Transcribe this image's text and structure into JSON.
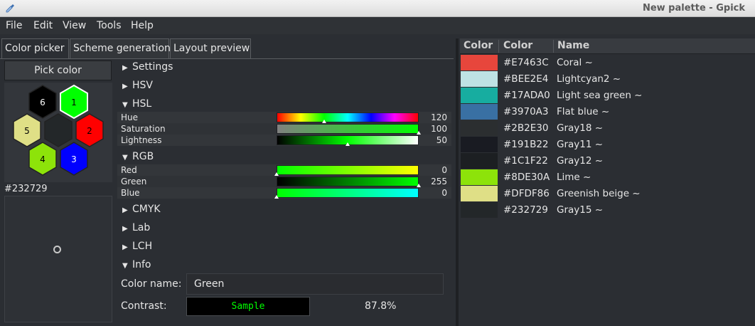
{
  "window": {
    "title": "New palette - Gpick"
  },
  "menu": [
    "File",
    "Edit",
    "View",
    "Tools",
    "Help"
  ],
  "tabs": [
    "Color picker",
    "Scheme generation",
    "Layout preview"
  ],
  "picker": {
    "pick_button": "Pick color",
    "current_hex": "#232729",
    "hexagons": [
      {
        "label": "6",
        "color": "#000000"
      },
      {
        "label": "1",
        "color": "#00ff00"
      },
      {
        "label": "2",
        "color": "#ff0000"
      },
      {
        "label": "3",
        "color": "#0000ff"
      },
      {
        "label": "4",
        "color": "#8de30a"
      },
      {
        "label": "5",
        "color": "#dfdf86"
      }
    ]
  },
  "sections": {
    "settings": "Settings",
    "hsv": "HSV",
    "hsl": "HSL",
    "rgb": "RGB",
    "cmyk": "CMYK",
    "lab": "Lab",
    "lch": "LCH",
    "info": "Info"
  },
  "hsl": {
    "hue": {
      "label": "Hue",
      "value": "120",
      "level": 0.333
    },
    "saturation": {
      "label": "Saturation",
      "value": "100",
      "level": 1.0
    },
    "lightness": {
      "label": "Lightness",
      "value": "50",
      "level": 0.5
    }
  },
  "rgb": {
    "red": {
      "label": "Red",
      "value": "0",
      "level": 0.0
    },
    "green": {
      "label": "Green",
      "value": "255",
      "level": 1.0
    },
    "blue": {
      "label": "Blue",
      "value": "0",
      "level": 0.0
    }
  },
  "info": {
    "color_name_label": "Color name:",
    "color_name": "Green",
    "contrast_label": "Contrast:",
    "sample": "Sample",
    "contrast_value": "87.8%"
  },
  "palette": {
    "headers": [
      "Color",
      "Color",
      "Name"
    ],
    "rows": [
      {
        "color": "#E7463C",
        "hex": "#E7463C",
        "name": "Coral ~"
      },
      {
        "color": "#BEE2E4",
        "hex": "#BEE2E4",
        "name": "Lightcyan2 ~"
      },
      {
        "color": "#17ADA0",
        "hex": "#17ADA0",
        "name": "Light sea green ~"
      },
      {
        "color": "#3970A3",
        "hex": "#3970A3",
        "name": "Flat blue ~"
      },
      {
        "color": "#2B2E30",
        "hex": "#2B2E30",
        "name": "Gray18 ~"
      },
      {
        "color": "#191B22",
        "hex": "#191B22",
        "name": "Gray11 ~"
      },
      {
        "color": "#1C1F22",
        "hex": "#1C1F22",
        "name": "Gray12 ~"
      },
      {
        "color": "#8DE30A",
        "hex": "#8DE30A",
        "name": "Lime ~"
      },
      {
        "color": "#DFDF86",
        "hex": "#DFDF86",
        "name": "Greenish beige ~"
      },
      {
        "color": "#232729",
        "hex": "#232729",
        "name": "Gray15 ~"
      }
    ]
  }
}
